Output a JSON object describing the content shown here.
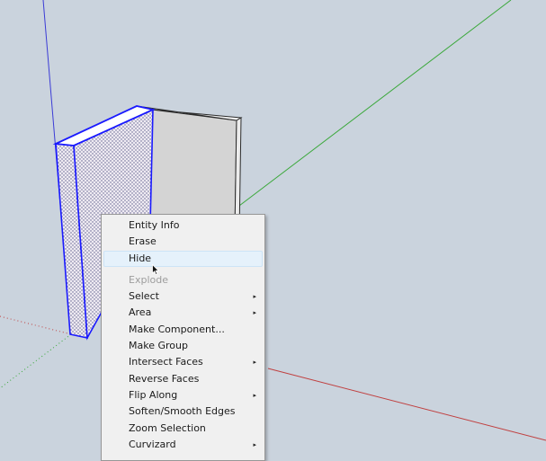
{
  "context_menu": {
    "items": [
      {
        "label": "Entity Info",
        "submenu": false
      },
      {
        "label": "Erase",
        "submenu": false
      },
      {
        "label": "Hide",
        "submenu": false,
        "highlighted": true
      },
      {
        "label": "Explode",
        "submenu": false,
        "disabled": true
      },
      {
        "label": "Select",
        "submenu": true
      },
      {
        "label": "Area",
        "submenu": true
      },
      {
        "label": "Make Component...",
        "submenu": false
      },
      {
        "label": "Make Group",
        "submenu": false
      },
      {
        "label": "Intersect Faces",
        "submenu": true
      },
      {
        "label": "Reverse Faces",
        "submenu": false
      },
      {
        "label": "Flip Along",
        "submenu": true
      },
      {
        "label": "Soften/Smooth Edges",
        "submenu": false
      },
      {
        "label": "Zoom Selection",
        "submenu": false
      },
      {
        "label": "Curvizard",
        "submenu": true
      }
    ],
    "submenu_arrow": "▸"
  },
  "colors": {
    "background": "#cad3dd",
    "axis_blue": "#3b3bd6",
    "axis_green": "#3aa83a",
    "axis_red": "#c04040",
    "selection_blue": "#1a1aff",
    "face_gray": "#d4d4d4",
    "menu_highlight": "#e5f1fb"
  },
  "icons": {
    "cursor": "arrow-pointer-icon"
  }
}
